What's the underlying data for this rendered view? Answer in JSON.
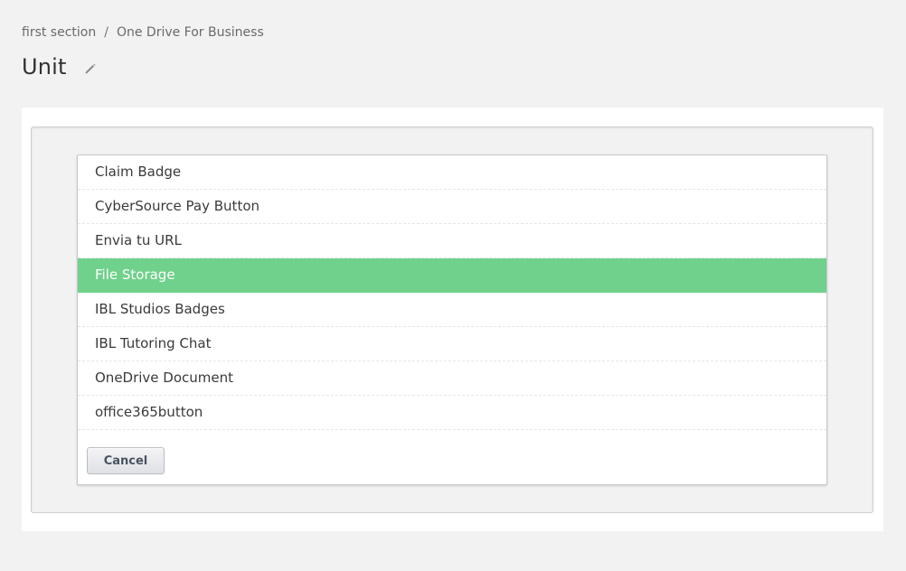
{
  "breadcrumb": {
    "section": "first section",
    "separator": "/",
    "subsection": "One Drive For Business"
  },
  "page": {
    "title": "Unit",
    "edit_icon": "pencil-icon"
  },
  "component_menu": {
    "items": [
      {
        "label": "Claim Badge"
      },
      {
        "label": "CyberSource Pay Button"
      },
      {
        "label": "Envia tu URL"
      },
      {
        "label": "File Storage"
      },
      {
        "label": "IBL Studios Badges"
      },
      {
        "label": "IBL Tutoring Chat"
      },
      {
        "label": "OneDrive Document"
      },
      {
        "label": "office365button"
      }
    ],
    "selected_label": "File Storage",
    "cancel_label": "Cancel"
  },
  "colors": {
    "background": "#f2f2f2",
    "selected_item": "#6fd18b",
    "text": "#3a3a3a"
  }
}
